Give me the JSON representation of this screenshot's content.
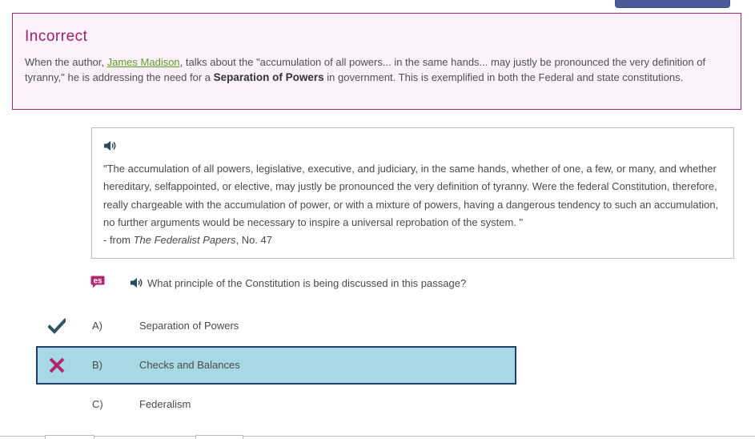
{
  "feedback": {
    "title": "Incorrect",
    "text_before_link": "When the author, ",
    "author_link": "James Madison",
    "text_after_link": ", talks about the \"accumulation of all powers... in the same hands... may justly be pronounced the very definition of tyranny,\" he is addressing the need for a ",
    "bold_term": "Separation of Powers",
    "text_end": " in government. This is exemplified in both the Federal and state constitutions."
  },
  "passage": {
    "audio_icon": "speaker-icon",
    "quote": "\"The accumulation of all powers, legislative, executive, and judiciary, in the same hands, whether of one, a few, or many, and whether hereditary, selfappointed, or elective, may justly be pronounced the very definition of tyranny. Were the federal Constitution, therefore, really chargeable with the accumulation of power, or with a mixture of powers, having a dangerous tendency to such an accumulation, no further arguments would be necessary to inspire a universal reprobation of the system. \"",
    "source_prefix": "- from ",
    "source_title": "The Federalist Papers",
    "source_suffix": ", No. 47"
  },
  "question": {
    "spanish_icon": "es-translation-icon",
    "audio_icon": "speaker-icon",
    "text": "What principle of the Constitution is being discussed in this passage?"
  },
  "answers": [
    {
      "letter": "A)",
      "text": "Separation of Powers",
      "status": "correct",
      "icon": "checkmark-icon"
    },
    {
      "letter": "B)",
      "text": "Checks and Balances",
      "status": "incorrect-selected",
      "icon": "x-icon"
    },
    {
      "letter": "C)",
      "text": "Federalism",
      "status": "none",
      "icon": ""
    }
  ],
  "colors": {
    "feedback_accent": "#9a1f6e",
    "feedback_bg": "#fdf1fb",
    "link_green": "#5c9d2a",
    "selected_bg": "#a8d8e3",
    "selected_border": "#1f3f72",
    "check_color": "#2f5563",
    "x_color": "#b0266f"
  }
}
